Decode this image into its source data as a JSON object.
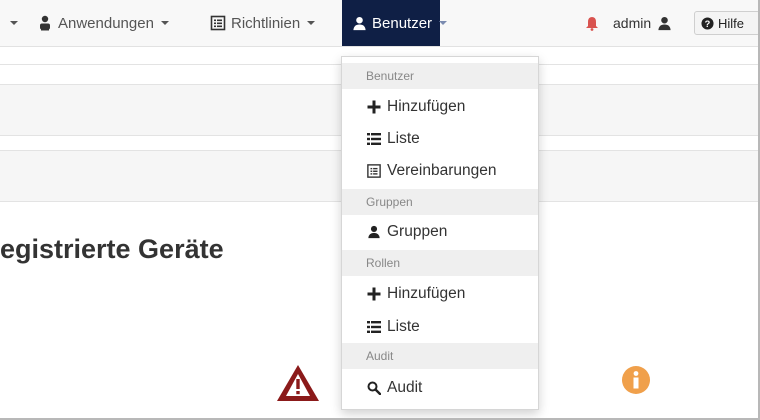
{
  "navbar": {
    "left_caret": "",
    "anwendungen": {
      "label": "Anwendungen",
      "icon": "user-tie-icon"
    },
    "richtlinien": {
      "label": "Richtlinien",
      "icon": "list-alt-icon"
    },
    "benutzer": {
      "label": "Benutzer",
      "icon": "user-icon"
    },
    "notifications_icon": "bell-icon",
    "user": {
      "label": "admin",
      "icon": "user-icon"
    },
    "help": {
      "label": "Hilfe",
      "icon": "question-circle-icon"
    }
  },
  "page": {
    "heading": "egistrierte Geräte",
    "warning_icon": "warning-triangle-icon",
    "info_icon": "info-circle-icon"
  },
  "benutzer_menu": {
    "sections": [
      {
        "header": "Benutzer",
        "items": [
          {
            "label": "Hinzufügen",
            "icon": "plus-icon"
          },
          {
            "label": "Liste",
            "icon": "list-icon"
          },
          {
            "label": "Vereinbarungen",
            "icon": "list-alt-icon"
          }
        ]
      },
      {
        "header": "Gruppen",
        "items": [
          {
            "label": "Gruppen",
            "icon": "user-icon"
          }
        ]
      },
      {
        "header": "Rollen",
        "items": [
          {
            "label": "Hinzufügen",
            "icon": "plus-icon"
          },
          {
            "label": "Liste",
            "icon": "list-icon"
          }
        ]
      },
      {
        "header": "Audit",
        "items": [
          {
            "label": "Audit",
            "icon": "search-icon"
          }
        ]
      }
    ]
  },
  "colors": {
    "nav_active_bg": "#0f1f45",
    "bell": "#d9534f",
    "warning": "#8b1a1a",
    "info": "#f0a04b"
  }
}
